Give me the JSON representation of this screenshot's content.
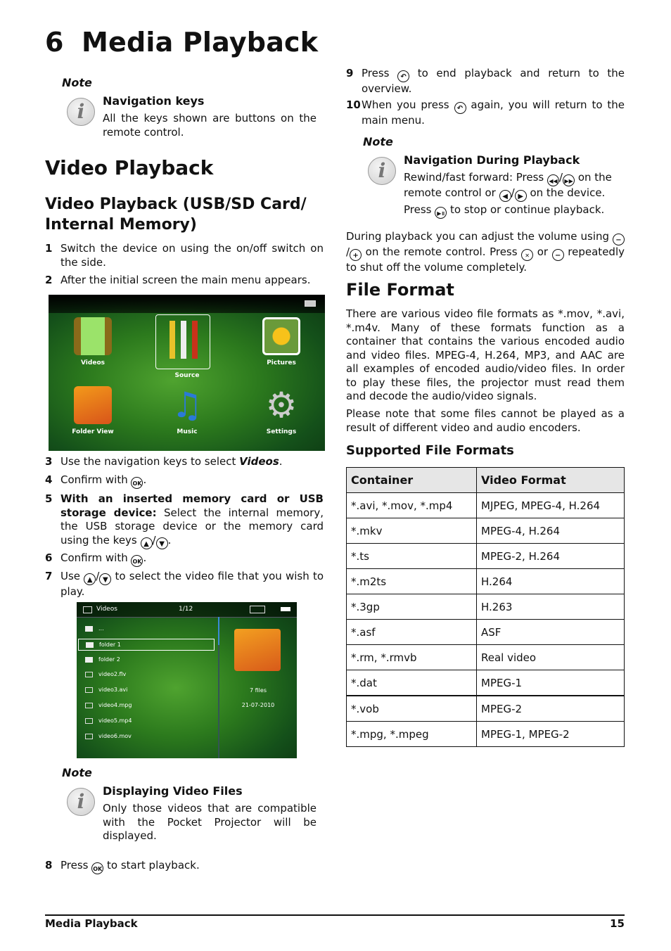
{
  "chapter": {
    "number": "6",
    "title": "Media Playback"
  },
  "note1": {
    "label": "Note",
    "title": "Navigation keys",
    "body": "All the keys shown are buttons on the remote control."
  },
  "section": {
    "title": "Video Playback"
  },
  "subsection": {
    "title_line1": "Video Playback (USB/SD Card/",
    "title_line2": "Internal Memory)"
  },
  "steps": [
    {
      "n": "1",
      "text": "Switch the device on using the on/off switch on the side."
    },
    {
      "n": "2",
      "text": "After the initial screen the main menu appears."
    },
    {
      "n": "3",
      "text_before": "Use the navigation keys to select ",
      "emph": "Videos",
      "text_after": "."
    },
    {
      "n": "4",
      "text_before": "Confirm with ",
      "key": "OK",
      "text_after": "."
    },
    {
      "n": "5",
      "bold": "With an inserted memory card or USB storage device:",
      "text": " Select the internal memory, the USB storage device or the memory card using the keys ",
      "key1": "▲",
      "key2": "▼",
      "text_after": "."
    },
    {
      "n": "6",
      "text_before": "Confirm with ",
      "key": "OK",
      "text_after": "."
    },
    {
      "n": "7",
      "text_before": "Use ",
      "key1": "▲",
      "key2": "▼",
      "text_after": " to select the video file that you wish to play."
    },
    {
      "n": "8",
      "text_before": "Press ",
      "key": "OK",
      "text_after": " to start playback."
    },
    {
      "n": "9",
      "text_before": "Press ",
      "key": "↶",
      "text_after": " to end playback and return to the overview."
    },
    {
      "n": "10",
      "text_before": "When you press ",
      "key": "↶",
      "text_after": " again, you will return to the main menu."
    }
  ],
  "main_menu_screen": {
    "items": [
      "Videos",
      "Source",
      "Pictures",
      "Folder View",
      "Music",
      "Settings"
    ],
    "selected": "Source"
  },
  "video_browser_screen": {
    "title": "Videos",
    "counter": "1/12",
    "items": [
      {
        "type": "folder",
        "name": "..."
      },
      {
        "type": "folder",
        "name": "folder 1",
        "selected": true
      },
      {
        "type": "folder",
        "name": "folder 2"
      },
      {
        "type": "video",
        "name": "video2.flv"
      },
      {
        "type": "video",
        "name": "video3.avi"
      },
      {
        "type": "video",
        "name": "video4.mpg"
      },
      {
        "type": "video",
        "name": "video5.mp4"
      },
      {
        "type": "video",
        "name": "video6.mov"
      }
    ],
    "info_files": "7 files",
    "info_date": "21-07-2010"
  },
  "note2": {
    "label": "Note",
    "title": "Displaying Video Files",
    "body": "Only those videos that are compatible with the Pocket Projector will be displayed."
  },
  "note3": {
    "label": "Note",
    "title": "Navigation During Playback",
    "line1_before": "Rewind/fast forward: Press ",
    "line1_mid": " on the remote control or ",
    "line1_after": " on the device.",
    "line2_before": "Press ",
    "line2_after": " to stop or continue playback."
  },
  "volume_para": {
    "t1": "During playback you can adjust the volume using ",
    "t2": " on the remote control. Press ",
    "t3": " or ",
    "t4": " repeatedly to shut off the volume completely."
  },
  "file_format": {
    "title": "File Format",
    "para1": "There are various video file formats as *.mov, *.avi, *.m4v. Many of these formats function as a container that contains the various encoded audio and video files. MPEG-4, H.264, MP3, and AAC are all examples of encoded audio/video files. In order to play these files, the projector must read them and decode the audio/video signals.",
    "para2": "Please note that some files cannot be played as a result of different video and audio encoders."
  },
  "supported": {
    "title": "Supported File Formats",
    "headers": [
      "Container",
      "Video Format"
    ],
    "rows": [
      [
        "*.avi, *.mov, *.mp4",
        "MJPEG, MPEG-4, H.264"
      ],
      [
        "*.mkv",
        "MPEG-4, H.264"
      ],
      [
        "*.ts",
        "MPEG-2, H.264"
      ],
      [
        "*.m2ts",
        "H.264"
      ],
      [
        "*.3gp",
        "H.263"
      ],
      [
        "*.asf",
        "ASF"
      ],
      [
        "*.rm, *.rmvb",
        "Real video"
      ],
      [
        "*.dat",
        "MPEG-1"
      ],
      [
        "*.vob",
        "MPEG-2"
      ],
      [
        "*.mpg, *.mpeg",
        "MPEG-1, MPEG-2"
      ]
    ]
  },
  "footer": {
    "left": "Media Playback",
    "page": "15"
  }
}
